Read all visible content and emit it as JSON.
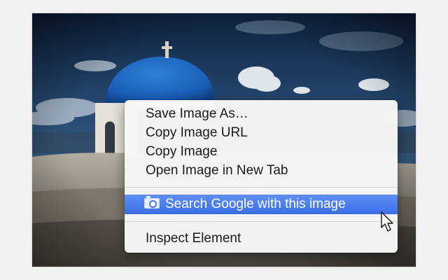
{
  "context_menu": {
    "items": [
      {
        "label": "Save Image As…"
      },
      {
        "label": "Copy Image URL"
      },
      {
        "label": "Copy Image"
      },
      {
        "label": "Open Image in New Tab"
      }
    ],
    "highlighted_item": {
      "label": "Search Google with this image",
      "icon": "camera-icon"
    },
    "last_item": {
      "label": "Inspect Element"
    },
    "highlight_color": "#3a6fe7"
  },
  "photo": {
    "subject": "blue-domed-church-photo"
  },
  "pointer": {
    "icon": "arrow-cursor-icon"
  }
}
